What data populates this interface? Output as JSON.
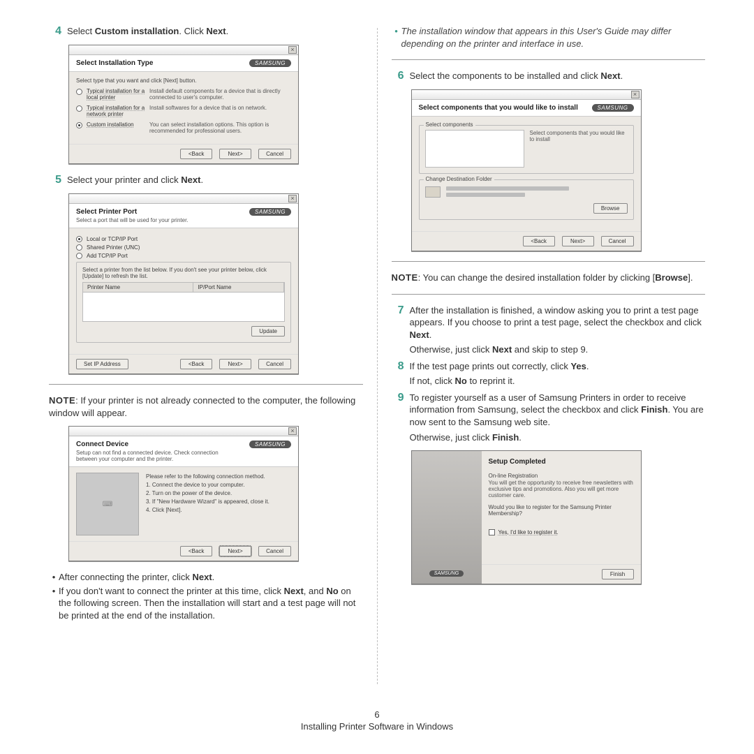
{
  "footer": {
    "page_num": "6",
    "title": "Installing Printer Software in Windows"
  },
  "brand": "SAMSUNG",
  "left": {
    "step4": {
      "num": "4",
      "text_a": "Select ",
      "text_b": "Custom installation",
      "text_c": ". Click ",
      "text_d": "Next",
      "text_e": "."
    },
    "dlg1": {
      "title": "Select Installation Type",
      "hint": "Select type that you want and click [Next] button.",
      "opt1_label": "Typical installation for a local printer",
      "opt1_desc": "Install default components for a device that is directly connected to user's computer.",
      "opt2_label": "Typical installation for a network printer",
      "opt2_desc": "Install softwares for a device that is on network.",
      "opt3_label": "Custom installation",
      "opt3_desc": "You can select installation options. This option is recommended for professional users.",
      "btn_back": "<Back",
      "btn_next": "Next>",
      "btn_cancel": "Cancel"
    },
    "step5": {
      "num": "5",
      "text_a": "Select your printer and click ",
      "text_b": "Next",
      "text_c": "."
    },
    "dlg2": {
      "title": "Select Printer Port",
      "sub": "Select a port that will be used for your printer.",
      "r1": "Local or TCP/IP Port",
      "r2": "Shared Printer (UNC)",
      "r3": "Add TCP/IP Port",
      "helper": "Select a printer from the list below. If you don't see your printer below, click [Update] to refresh the list.",
      "col1": "Printer Name",
      "col2": "IP/Port Name",
      "btn_update": "Update",
      "btn_setip": "Set IP Address",
      "btn_back": "<Back",
      "btn_next": "Next>",
      "btn_cancel": "Cancel"
    },
    "note1_a": "NOTE",
    "note1_b": ": If your printer is not already connected to the computer, the following window will appear.",
    "dlg3": {
      "title": "Connect Device",
      "sub": "Setup can not find a connected device. Check connection between your computer and the printer.",
      "intro": "Please refer to the following connection method.",
      "s1": "1. Connect the device to your computer.",
      "s2": "2. Turn on the power of the device.",
      "s3": "3. If \"New Hardware Wizard\" is appeared, close it.",
      "s4": "4. Click [Next].",
      "btn_back": "<Back",
      "btn_next": "Next>",
      "btn_cancel": "Cancel"
    },
    "b1_a": "After connecting the printer, click ",
    "b1_b": "Next",
    "b1_c": ".",
    "b2_a": "If you don't want to connect the printer at this time, click ",
    "b2_b": "Next",
    "b2_c": ", and ",
    "b2_d": "No",
    "b2_e": " on the following screen. Then the installation will start and a test page will not be printed at the end of the installation."
  },
  "right": {
    "italic_note": "The installation window that appears in this User's Guide may differ depending on the printer and interface in use.",
    "step6": {
      "num": "6",
      "text_a": "Select the components to be installed and click ",
      "text_b": "Next",
      "text_c": "."
    },
    "dlg4": {
      "title": "Select components that you would like to install",
      "gb_legend": "Select components",
      "gb_hint": "Select components that you would like to install",
      "cd_legend": "Change Destination Folder",
      "btn_browse": "Browse",
      "btn_back": "<Back",
      "btn_next": "Next>",
      "btn_cancel": "Cancel"
    },
    "note2_a": "NOTE",
    "note2_b": ": You can change the desired installation folder by clicking [",
    "note2_c": "Browse",
    "note2_d": "].",
    "step7": {
      "num": "7",
      "l1_a": "After the installation is finished, a window asking you to print a test page appears. If you choose to print a test page, select the checkbox and click ",
      "l1_b": "Next",
      "l1_c": ".",
      "l2_a": "Otherwise, just click ",
      "l2_b": "Next",
      "l2_c": " and skip to step 9."
    },
    "step8": {
      "num": "8",
      "l1_a": "If the test page prints out correctly, click ",
      "l1_b": "Yes",
      "l1_c": ".",
      "l2_a": "If not, click ",
      "l2_b": "No",
      "l2_c": " to reprint it."
    },
    "step9": {
      "num": "9",
      "l1_a": "To register yourself as a user of Samsung Printers in order to receive information from Samsung, select the checkbox and click ",
      "l1_b": "Finish",
      "l1_c": ". You are now sent to the Samsung web site.",
      "l2_a": "Otherwise, just click ",
      "l2_b": "Finish",
      "l2_c": "."
    },
    "dlg5": {
      "title": "Setup Completed",
      "p1": "On-line Registration",
      "p2": "You will get the opportunity to receive free newsletters with exclusive tips and promotions. Also you will get more customer care.",
      "p3": "Would you like to register for the Samsung Printer Membership?",
      "chk": "Yes, I'd like to register it.",
      "btn_finish": "Finish"
    }
  }
}
